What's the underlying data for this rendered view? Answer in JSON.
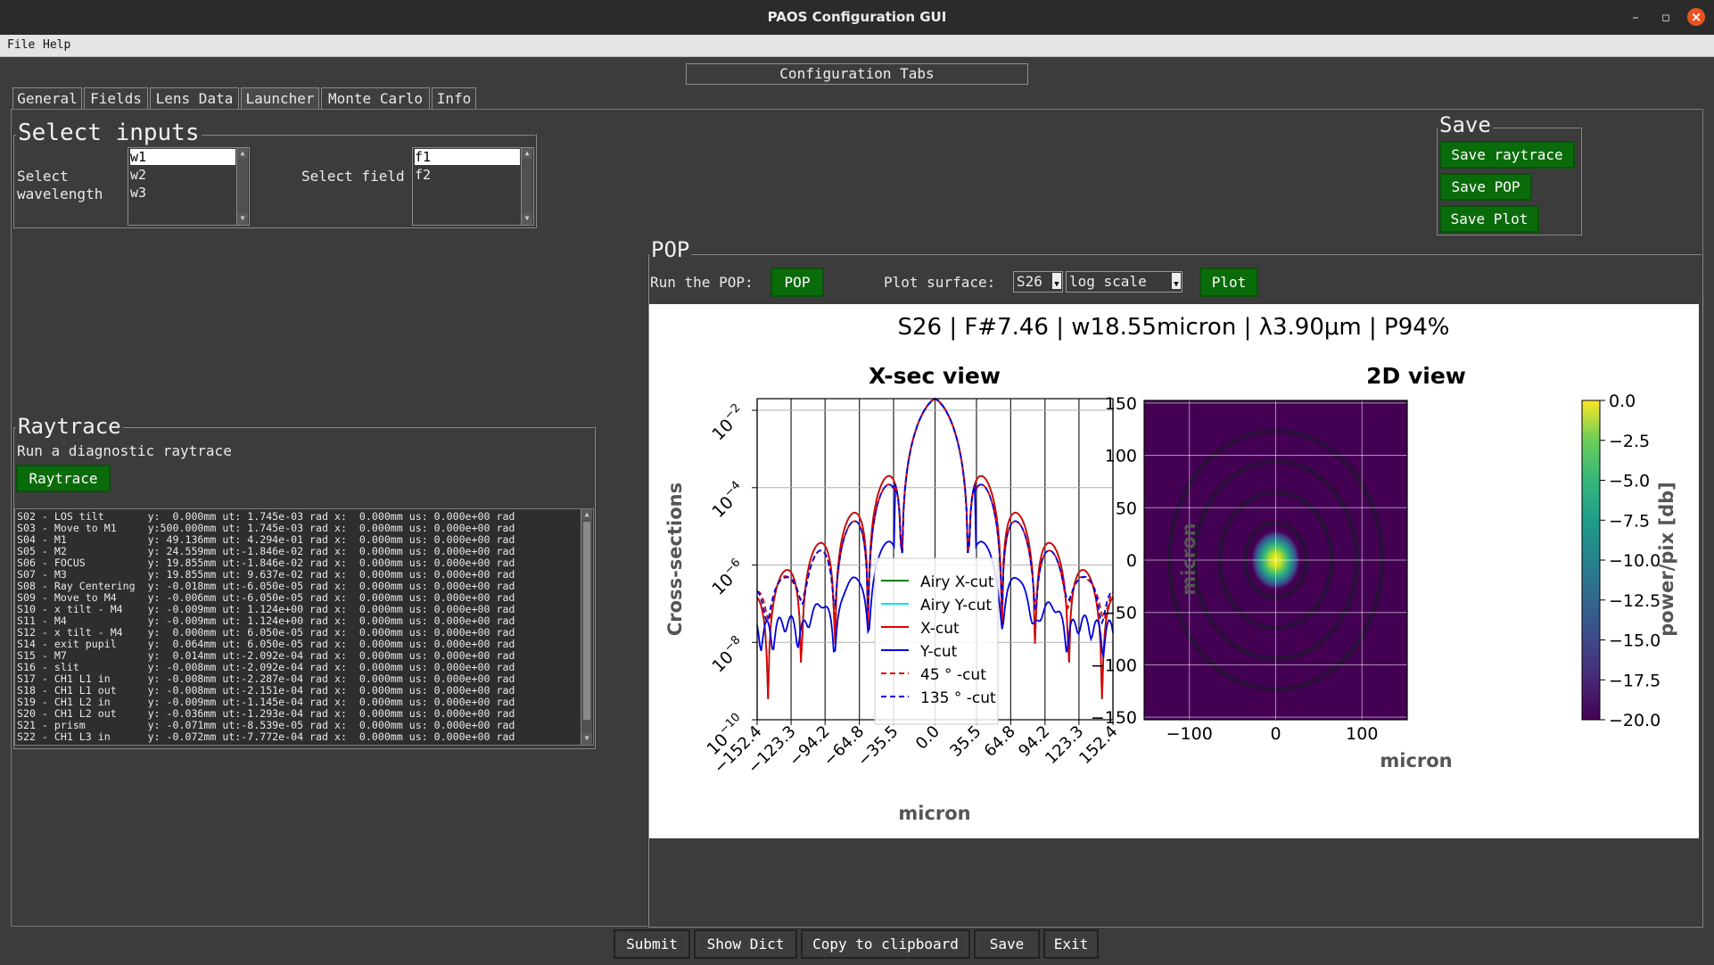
{
  "window": {
    "title": "PAOS Configuration GUI",
    "controls": {
      "minimize": "–",
      "maximize": "▫",
      "close": "×"
    }
  },
  "menu": {
    "file": "File",
    "help": "Help"
  },
  "config_tabs_label": "Configuration Tabs",
  "tabs": [
    {
      "label": "General"
    },
    {
      "label": "Fields"
    },
    {
      "label": "Lens Data"
    },
    {
      "label": "Launcher"
    },
    {
      "label": "Monte Carlo"
    },
    {
      "label": "Info"
    }
  ],
  "select_inputs": {
    "title": "Select inputs",
    "wavelength_label_1": "Select",
    "wavelength_label_2": "wavelength",
    "wavelengths": [
      "w1",
      "w2",
      "w3"
    ],
    "field_label": "Select field",
    "fields": [
      "f1",
      "f2"
    ]
  },
  "raytrace": {
    "title": "Raytrace",
    "subtitle": "Run a diagnostic raytrace",
    "button": "Raytrace",
    "log": [
      "S02 - LOS tilt       y:  0.000mm ut: 1.745e-03 rad x:  0.000mm us: 0.000e+00 rad",
      "S03 - Move to M1     y:500.000mm ut: 1.745e-03 rad x:  0.000mm us: 0.000e+00 rad",
      "S04 - M1             y: 49.136mm ut: 4.294e-01 rad x:  0.000mm us: 0.000e+00 rad",
      "S05 - M2             y: 24.559mm ut:-1.846e-02 rad x:  0.000mm us: 0.000e+00 rad",
      "S06 - FOCUS          y: 19.855mm ut:-1.846e-02 rad x:  0.000mm us: 0.000e+00 rad",
      "S07 - M3             y: 19.855mm ut: 9.637e-02 rad x:  0.000mm us: 0.000e+00 rad",
      "S08 - Ray Centering  y: -0.018mm ut:-6.050e-05 rad x:  0.000mm us: 0.000e+00 rad",
      "S09 - Move to M4     y: -0.006mm ut:-6.050e-05 rad x:  0.000mm us: 0.000e+00 rad",
      "S10 - x tilt - M4    y: -0.009mm ut: 1.124e+00 rad x:  0.000mm us: 0.000e+00 rad",
      "S11 - M4             y: -0.009mm ut: 1.124e+00 rad x:  0.000mm us: 0.000e+00 rad",
      "S12 - x tilt - M4    y:  0.000mm ut: 6.050e-05 rad x:  0.000mm us: 0.000e+00 rad",
      "S14 - exit pupil     y:  0.064mm ut: 6.050e-05 rad x:  0.000mm us: 0.000e+00 rad",
      "S15 - M7             y:  0.014mm ut:-2.092e-04 rad x:  0.000mm us: 0.000e+00 rad",
      "S16 - slit           y: -0.008mm ut:-2.092e-04 rad x:  0.000mm us: 0.000e+00 rad",
      "S17 - CH1 L1 in      y: -0.008mm ut:-2.287e-04 rad x:  0.000mm us: 0.000e+00 rad",
      "S18 - CH1 L1 out     y: -0.008mm ut:-2.151e-04 rad x:  0.000mm us: 0.000e+00 rad",
      "S19 - CH1 L2 in      y: -0.009mm ut:-1.145e-04 rad x:  0.000mm us: 0.000e+00 rad",
      "S20 - CH1 L2 out     y: -0.036mm ut:-1.293e-04 rad x:  0.000mm us: 0.000e+00 rad",
      "S21 - prism          y: -0.071mm ut:-8.539e-05 rad x:  0.000mm us: 0.000e+00 rad",
      "S22 - CH1 L3 in      y: -0.072mm ut:-7.772e-04 rad x:  0.000mm us: 0.000e+00 rad"
    ]
  },
  "save": {
    "title": "Save",
    "raytrace": "Save raytrace",
    "pop": "Save POP",
    "plot": "Save Plot"
  },
  "pop": {
    "title": "POP",
    "run_label": "Run the POP:",
    "run_button": "POP",
    "plot_surface_label": "Plot surface:",
    "surface_value": "S26",
    "scale_value": "log scale",
    "plot_button": "Plot"
  },
  "bottom_buttons": {
    "submit": "Submit",
    "show_dict": "Show Dict",
    "copy": "Copy to clipboard",
    "save": "Save",
    "exit": "Exit"
  },
  "colors": {
    "bg": "#3c3c3c",
    "green_button": "#0a6b0a",
    "airy_x": "#008000",
    "airy_y": "#00e5e5",
    "x_cut": "#e00000",
    "y_cut": "#0000dd"
  },
  "figure": {
    "suptitle": "S26 | F#7.46 | w18.55micron | λ3.90μm | P94%",
    "xsec": {
      "title": "X-sec view",
      "xlabel": "micron",
      "ylabel": "Cross-sections",
      "xticks": [
        "−152.4",
        "−123.3",
        "−94.2",
        "−64.8",
        "−35.5",
        "0.0",
        "35.5",
        "64.8",
        "94.2",
        "123.3",
        "152.4"
      ],
      "yticks": [
        {
          "base": "10",
          "exp": "−2",
          "value": -2
        },
        {
          "base": "10",
          "exp": "−4",
          "value": -4
        },
        {
          "base": "10",
          "exp": "−6",
          "value": -6
        },
        {
          "base": "10",
          "exp": "−8",
          "value": -8
        },
        {
          "base": "10",
          "exp": "−10",
          "value": -10
        }
      ],
      "legend": [
        "Airy X-cut",
        "Airy Y-cut",
        "X-cut",
        "Y-cut",
        "45 ° -cut",
        "135 ° -cut"
      ]
    },
    "view2d": {
      "title": "2D view",
      "xlabel": "micron",
      "ylabel": "micron",
      "xticks": [
        "−100",
        "0",
        "100"
      ],
      "yticks": [
        "150",
        "100",
        "50",
        "0",
        "−50",
        "−100",
        "−150"
      ],
      "colorbar_label": "power/pix [db]",
      "colorbar_ticks": [
        "0.0",
        "−2.5",
        "−5.0",
        "−7.5",
        "−10.0",
        "−12.5",
        "−15.0",
        "−17.5",
        "−20.0"
      ]
    }
  },
  "chart_data": [
    {
      "type": "line",
      "title": "X-sec view",
      "xlabel": "micron",
      "ylabel": "Cross-sections",
      "yscale": "log",
      "xlim": [
        -152.4,
        152.4
      ],
      "ylim": [
        1e-10,
        0.02
      ],
      "grid": true,
      "legend_position": "lower center",
      "x": [
        -152.4,
        -123.3,
        -94.2,
        -64.8,
        -35.5,
        0.0,
        35.5,
        64.8,
        94.2,
        123.3,
        152.4
      ],
      "series": [
        {
          "name": "Airy X-cut",
          "line": "solid",
          "color": "#008000",
          "values": [
            1e-09,
            1e-08,
            1e-08,
            1e-08,
            1e-08,
            0.02,
            1e-08,
            1e-08,
            1e-08,
            1e-08,
            1e-09
          ]
        },
        {
          "name": "Airy Y-cut",
          "line": "solid",
          "color": "#00e5e5",
          "values": [
            1e-09,
            1e-08,
            1e-08,
            1e-08,
            1e-08,
            0.02,
            1e-08,
            1e-08,
            1e-08,
            1e-08,
            1e-09
          ]
        },
        {
          "name": "X-cut",
          "line": "solid",
          "color": "#e00000",
          "values": [
            1e-09,
            1e-08,
            1e-08,
            1e-08,
            1e-08,
            0.02,
            1e-08,
            1e-08,
            1e-08,
            1e-08,
            1e-09
          ]
        },
        {
          "name": "Y-cut",
          "line": "solid",
          "color": "#0000dd",
          "values": [
            4e-07,
            3e-08,
            1e-08,
            1e-07,
            4e-08,
            0.02,
            4e-08,
            1e-07,
            1e-08,
            3e-08,
            4e-07
          ]
        },
        {
          "name": "45 ° -cut",
          "line": "dashed",
          "color": "#e00000",
          "values": [
            2e-07,
            5e-07,
            2e-07,
            1e-07,
            3e-08,
            0.02,
            3e-08,
            1e-07,
            2e-07,
            5e-07,
            2e-07
          ]
        },
        {
          "name": "135 ° -cut",
          "line": "dashed",
          "color": "#0000dd",
          "values": [
            2e-07,
            5e-07,
            2e-07,
            1e-07,
            3e-08,
            0.02,
            3e-08,
            1e-07,
            2e-07,
            5e-07,
            2e-07
          ]
        }
      ]
    },
    {
      "type": "heatmap",
      "title": "2D view",
      "xlabel": "micron",
      "ylabel": "micron",
      "xlim": [
        -152.4,
        152.4
      ],
      "ylim": [
        -152.4,
        152.4
      ],
      "colorbar": {
        "label": "power/pix [db]",
        "range": [
          -20.0,
          0.0
        ],
        "colormap": "viridis"
      },
      "rings_micron": [
        35.5,
        64.8,
        94.2,
        123.3,
        152.4
      ],
      "peak": {
        "x": 0,
        "y": 0,
        "value": 0.0
      }
    }
  ]
}
